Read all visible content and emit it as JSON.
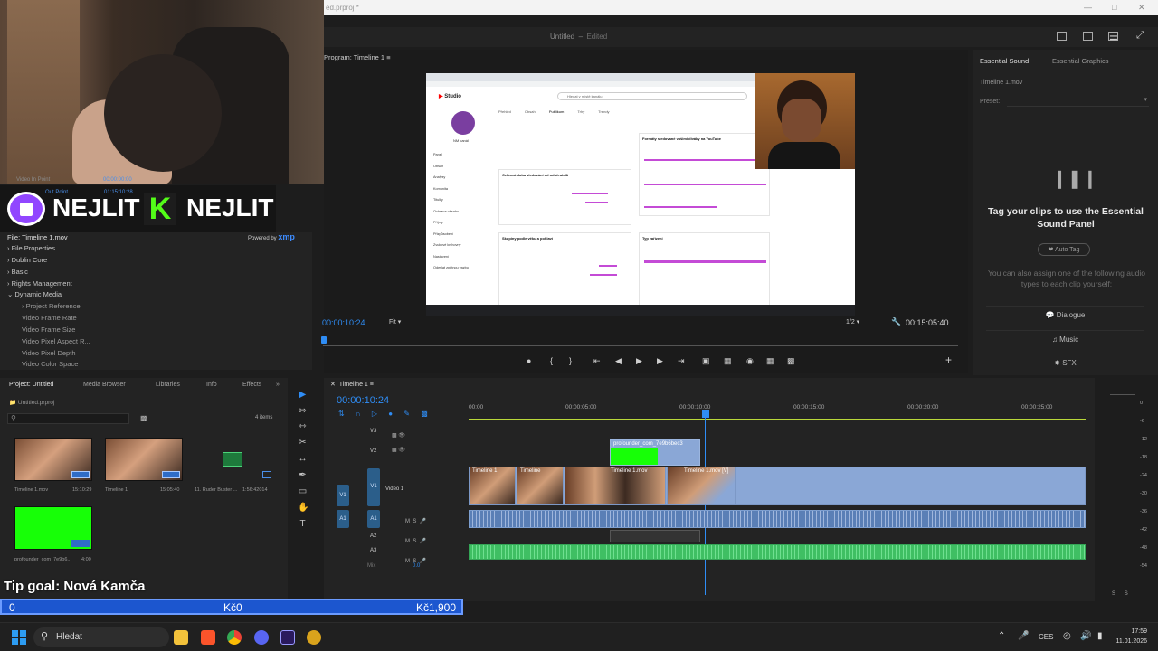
{
  "window": {
    "title": "ed.prproj *",
    "doc_title": "Untitled",
    "doc_status": "Edited"
  },
  "overlay": {
    "brand_left": "NEJLIT",
    "brand_right": "NEJLIT",
    "powered_by": "Powered by",
    "xmp": "xmp",
    "tip_goal": "Tip goal: Nová Kamča",
    "goal_current": "0",
    "goal_center": "Kč0",
    "goal_target": "Kč1,900"
  },
  "metadata": {
    "faint_rows": [
      "Video In Point",
      "Out Point"
    ],
    "faint_values": [
      "00:00:00:00",
      "01:15:10:28"
    ],
    "file": "File:  Timeline 1.mov",
    "rows": [
      {
        "label": "File Properties",
        "level": 0
      },
      {
        "label": "Dublin Core",
        "level": 0
      },
      {
        "label": "Basic",
        "level": 0
      },
      {
        "label": "Rights Management",
        "level": 0
      },
      {
        "label": "Dynamic Media",
        "level": 0
      },
      {
        "label": "Project Reference",
        "level": 1
      },
      {
        "label": "Video Frame Rate",
        "level": 1
      },
      {
        "label": "Video Frame Size",
        "level": 1
      },
      {
        "label": "Video Pixel Aspect R...",
        "level": 1
      },
      {
        "label": "Video Pixel Depth",
        "level": 1
      },
      {
        "label": "Video Color Space",
        "level": 1
      }
    ]
  },
  "project": {
    "tabs": [
      "Project: Untitled",
      "Media Browser",
      "Libraries",
      "Info",
      "Effects"
    ],
    "file": "Untitled.prproj",
    "items_count": "4 items",
    "items": [
      {
        "name": "Timeline 1.mov",
        "duration": "15:10:29"
      },
      {
        "name": "Timeline 1",
        "duration": "15:05:40"
      },
      {
        "name": "11. Ruder Buster ...",
        "duration": "1:56:42014"
      },
      {
        "name": "profounder_com_7e9b6...",
        "duration": "4:00"
      }
    ]
  },
  "program": {
    "title": "Program: Timeline 1",
    "timecode": "00:00:10:24",
    "fit": "Fit",
    "resolution": "1/2",
    "duration": "00:15:05:40",
    "inner": {
      "studio": "Studio",
      "search": "Hledat v místě kanálu",
      "tabs": [
        "Přehled",
        "Obsah",
        "Publikum",
        "Trhy",
        "Trendy"
      ],
      "channel": "NM kanál",
      "nav": [
        "Panel",
        "Obsah",
        "Analýzy",
        "Komunita",
        "Titulky",
        "Ochrana obsahu",
        "Příjmy",
        "Přizpůsobení",
        "Zvukové knihovny",
        "Nastavení",
        "Odeslat zpětnou vazbu"
      ],
      "card1": "Celková doba sledování od odběratelů",
      "card2": "Skupiny podle věku a pohlaví",
      "card3": "Formáty sledované vašimi diváky na YouTube",
      "card4": "Typ zařízení"
    }
  },
  "essential_sound": {
    "tabs": [
      "Essential Sound",
      "Essential Graphics"
    ],
    "clip": "Timeline 1.mov",
    "preset_label": "Preset:",
    "headline": "Tag your clips to use the Essential Sound Panel",
    "auto_tag": "Auto Tag",
    "hint": "You can also assign one of the following audio types to each clip yourself:",
    "types": [
      "Dialogue",
      "Music",
      "SFX"
    ]
  },
  "timeline": {
    "tab": "Timeline 1",
    "timecode": "00:00:10:24",
    "ruler": [
      "00:00",
      "00:00:05:00",
      "00:00:10:00",
      "00:00:15:00",
      "00:00:20:00",
      "00:00:25:00"
    ],
    "tracks": [
      "V3",
      "V2",
      "V1",
      "A1",
      "A2",
      "A3"
    ],
    "video_label": "Video 1",
    "mix_label": "Mix",
    "mix_value": "0.0",
    "clips": {
      "v2": "profounder_com_7e9b6bec3",
      "v1a": "Timeline 1",
      "v1b": "Timeline",
      "v1c": "Timeline 1.mov",
      "v1d": "Timeline 1.mov [V]"
    },
    "meter_scale": [
      "0",
      "-6",
      "-12",
      "-18",
      "-24",
      "-30",
      "-36",
      "-42",
      "-48",
      "-54"
    ],
    "meter_labels": [
      "S",
      "S"
    ]
  },
  "taskbar": {
    "search": "Hledat",
    "lang": "CES",
    "time": "17:59",
    "date": "11.01.2026"
  },
  "colors": {
    "accent": "#2f8df5",
    "green": "#4cfb1c",
    "goal": "#1c56cf"
  }
}
